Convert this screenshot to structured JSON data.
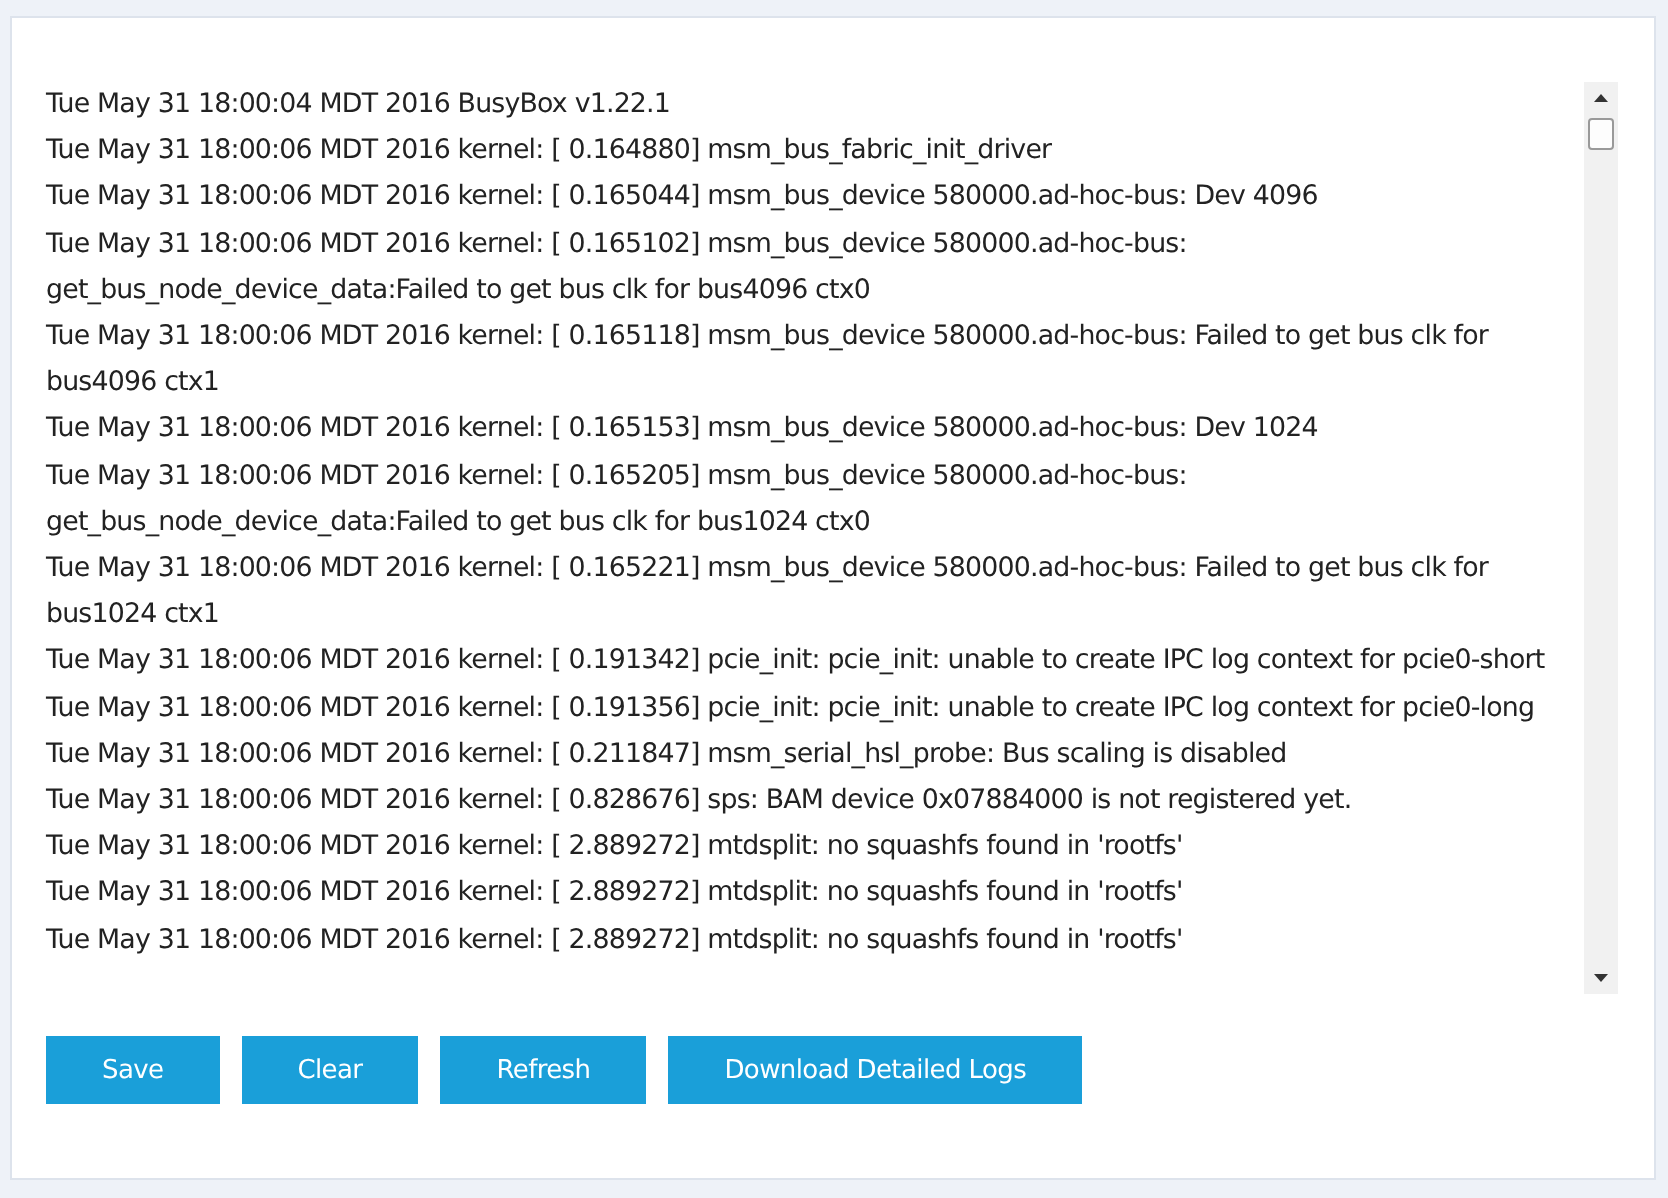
{
  "log": {
    "lines": [
      "Tue May 31 18:00:04 MDT 2016 BusyBox v1.22.1",
      "Tue May 31 18:00:06 MDT 2016 kernel: [ 0.164880] msm_bus_fabric_init_driver",
      "Tue May 31 18:00:06 MDT 2016 kernel: [ 0.165044] msm_bus_device 580000.ad-hoc-bus: Dev 4096",
      "Tue May 31 18:00:06 MDT 2016 kernel: [ 0.165102] msm_bus_device 580000.ad-hoc-bus: get_bus_node_device_data:Failed to get bus clk for bus4096 ctx0",
      "Tue May 31 18:00:06 MDT 2016 kernel: [ 0.165118] msm_bus_device 580000.ad-hoc-bus: Failed to get bus clk for bus4096 ctx1",
      "Tue May 31 18:00:06 MDT 2016 kernel: [ 0.165153] msm_bus_device 580000.ad-hoc-bus: Dev 1024",
      "Tue May 31 18:00:06 MDT 2016 kernel: [ 0.165205] msm_bus_device 580000.ad-hoc-bus: get_bus_node_device_data:Failed to get bus clk for bus1024 ctx0",
      "Tue May 31 18:00:06 MDT 2016 kernel: [ 0.165221] msm_bus_device 580000.ad-hoc-bus: Failed to get bus clk for bus1024 ctx1",
      "Tue May 31 18:00:06 MDT 2016 kernel: [ 0.191342] pcie_init: pcie_init: unable to create IPC log context for pcie0-short",
      "Tue May 31 18:00:06 MDT 2016 kernel: [ 0.191356] pcie_init: pcie_init: unable to create IPC log context for pcie0-long",
      "Tue May 31 18:00:06 MDT 2016 kernel: [ 0.211847] msm_serial_hsl_probe: Bus scaling is disabled",
      "Tue May 31 18:00:06 MDT 2016 kernel: [ 0.828676] sps: BAM device 0x07884000 is not registered yet.",
      "Tue May 31 18:00:06 MDT 2016 kernel: [ 2.889272] mtdsplit: no squashfs found in 'rootfs'",
      "Tue May 31 18:00:06 MDT 2016 kernel: [ 2.889272] mtdsplit: no squashfs found in 'rootfs'",
      "Tue May 31 18:00:06 MDT 2016 kernel: [ 2.889272] mtdsplit: no squashfs found in 'rootfs'"
    ]
  },
  "buttons": [
    "Save",
    "Clear",
    "Refresh",
    "Download Detailed Logs"
  ]
}
